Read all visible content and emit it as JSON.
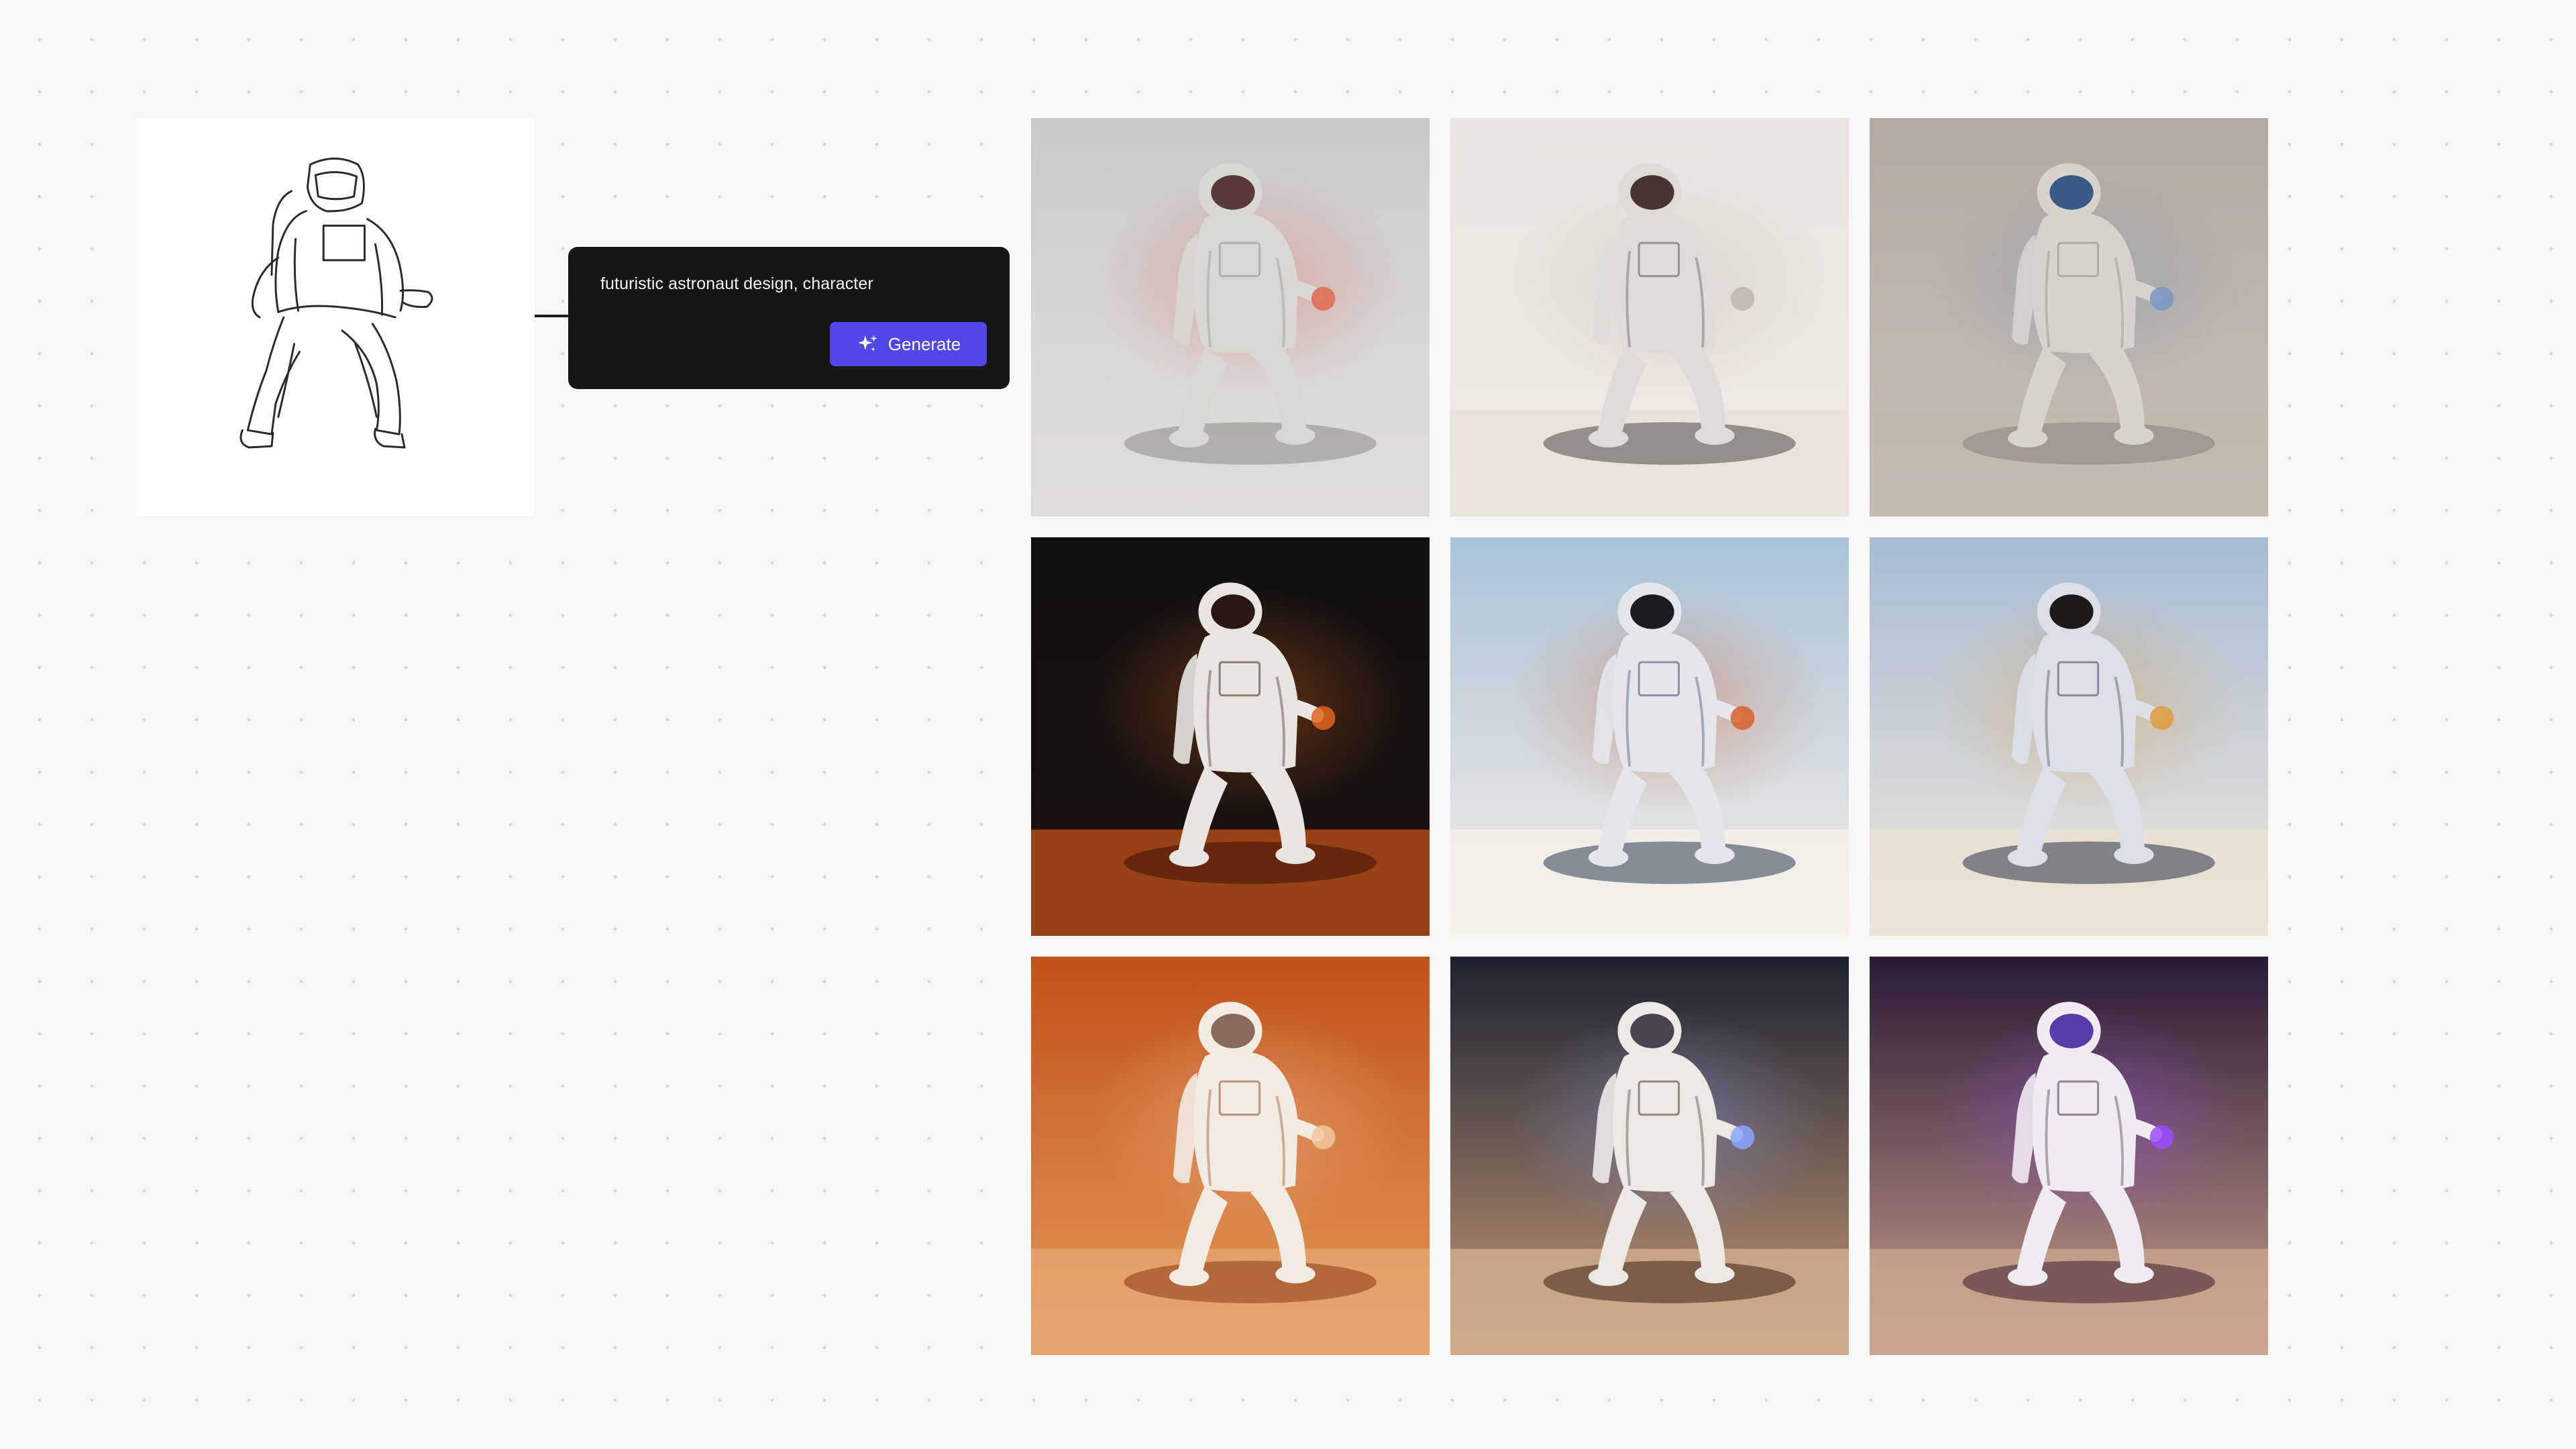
{
  "prompt_node": {
    "prompt_text": "futuristic astronaut design, character",
    "generate_label": "Generate"
  },
  "sketch": {
    "icon": "astronaut-line-sketch"
  },
  "results": [
    {
      "style": "soft-grey-studio",
      "bg_top": "#c9c9cb",
      "bg_bottom": "#e2e1df",
      "suit": "#d9d7d2",
      "visor": "#5a3a38",
      "floor": "#dcdad6",
      "shadow": "#8c8a88",
      "accent": "#e06a50"
    },
    {
      "style": "hazy-beige-studio",
      "bg_top": "#e9e4df",
      "bg_bottom": "#efe9e2",
      "suit": "#dedbd6",
      "visor": "#4a3432",
      "floor": "#e8e2da",
      "shadow": "#4a4846",
      "accent": "#bcb6ae"
    },
    {
      "style": "taupe-studio",
      "bg_top": "#b4aa9f",
      "bg_bottom": "#c8bfb4",
      "suit": "#d6d2cc",
      "visor": "#3c5a86",
      "floor": "#c2b8ac",
      "shadow": "#8a8078",
      "accent": "#7a96c2"
    },
    {
      "style": "fiery-dark-painting",
      "bg_top": "#121010",
      "bg_bottom": "#1a120e",
      "suit": "#e7e4e2",
      "visor": "#2a1612",
      "floor": "#c4521a",
      "shadow": "#3a1408",
      "accent": "#e0651f"
    },
    {
      "style": "desert-pastel-painting",
      "bg_top": "#a9c2d7",
      "bg_bottom": "#f5efe7",
      "suit": "#e4e6ec",
      "visor": "#1a1c22",
      "floor": "#f6f1ea",
      "shadow": "#2b3a55",
      "accent": "#d8602a"
    },
    {
      "style": "dusty-blue-painting",
      "bg_top": "#a6bcd4",
      "bg_bottom": "#efe6da",
      "suit": "#dcdfe8",
      "visor": "#1e1a1a",
      "floor": "#ece2d2",
      "shadow": "#2a3448",
      "accent": "#e09a3a"
    },
    {
      "style": "orange-cave-painting",
      "bg_top": "#c2521c",
      "bg_bottom": "#e49a5a",
      "suit": "#f1ebe2",
      "visor": "#8a6a5a",
      "floor": "#e8a873",
      "shadow": "#8a3a12",
      "accent": "#f3c7a0"
    },
    {
      "style": "night-desert-painting",
      "bg_top": "#1c2230",
      "bg_bottom": "#c79a78",
      "suit": "#ece9e4",
      "visor": "#4a4450",
      "floor": "#d6b090",
      "shadow": "#3a2418",
      "accent": "#8aa4ff"
    },
    {
      "style": "violet-cave-painting",
      "bg_top": "#2a1a36",
      "bg_bottom": "#c9a08a",
      "suit": "#f0eaf2",
      "visor": "#5a3aa8",
      "floor": "#cfa690",
      "shadow": "#3a2030",
      "accent": "#9b4dff"
    }
  ]
}
